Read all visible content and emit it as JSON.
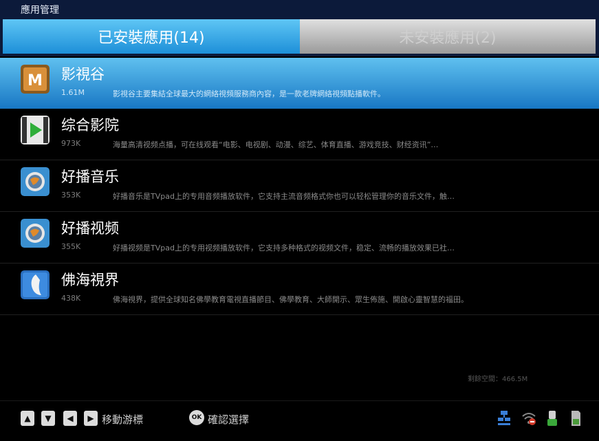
{
  "window": {
    "title": "應用管理"
  },
  "tabs": [
    {
      "label": "已安裝應用(14)",
      "active": true
    },
    {
      "label": "未安裝應用(2)",
      "active": false
    }
  ],
  "apps": [
    {
      "name": "影視谷",
      "size": "1.61M",
      "desc": "影視谷主要集結全球最大的網絡視頻服務商內容，是一款老牌網絡視頻點播軟件。",
      "icon": "movie-valley-icon",
      "selected": true
    },
    {
      "name": "综合影院",
      "size": "973K",
      "desc": "海量高清视频点播，可在线观看“电影、电视剧、动漫、综艺、体育直播、游戏竞技、财经资讯”…",
      "icon": "play-film-icon",
      "selected": false
    },
    {
      "name": "好播音乐",
      "size": "353K",
      "desc": "好播音乐是TVpad上的专用音频播放软件，它支持主流音频格式你也可以轻松管理你的音乐文件，触…",
      "icon": "globe-music-icon",
      "selected": false
    },
    {
      "name": "好播视频",
      "size": "355K",
      "desc": "好播视频是TVpad上的专用视频播放软件，它支持多种格式的视频文件，稳定、流畅的播放效果已社…",
      "icon": "globe-video-icon",
      "selected": false
    },
    {
      "name": "佛海視界",
      "size": "438K",
      "desc": "佛海視界，提供全球知名佛學教育電視直播節目、佛學教育、大師開示、眾生佈施、開啟心靈智慧的福田。",
      "icon": "buddha-icon",
      "selected": false
    }
  ],
  "storage": {
    "label": "剩餘空間：466.5M"
  },
  "footer": {
    "nav_keys": [
      "▲",
      "▼",
      "◀",
      "▶"
    ],
    "move_label": "移動游標",
    "ok_key": "OK",
    "confirm_label": "確認選擇"
  },
  "status_icons": [
    "network-icon",
    "wifi-icon",
    "usb-icon",
    "sd-card-icon"
  ],
  "colors": {
    "selected_row": "#2b8fd8",
    "active_tab": "#3aaef0",
    "inactive_tab": "#bdbdbd"
  }
}
